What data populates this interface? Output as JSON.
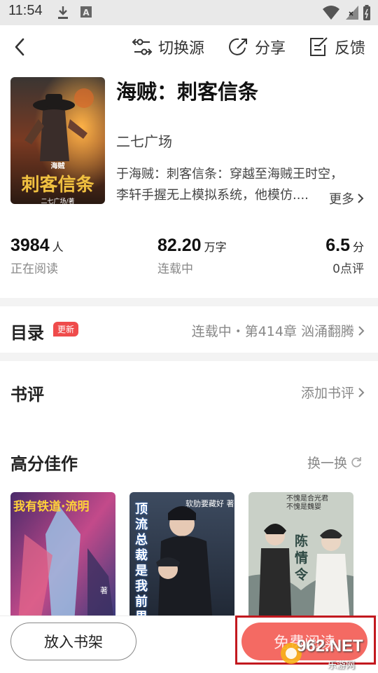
{
  "status_bar": {
    "time": "11:54"
  },
  "top_bar": {
    "switch_source": "切换源",
    "share": "分享",
    "feedback": "反馈"
  },
  "book": {
    "title": "海贼：刺客信条",
    "author": "二七广场",
    "desc_line1": "于海贼：刺客信条：穿越至海贼王时空，",
    "desc_line2": "李轩手握无上模拟系统，他模仿....",
    "more": "更多",
    "cover_title": "刺客信条",
    "cover_sub": "海贼",
    "cover_author": "二七广场/著"
  },
  "stats": [
    {
      "value": "3984",
      "unit": "人",
      "label": "正在阅读"
    },
    {
      "value": "82.20",
      "unit": "万字",
      "label": "连载中"
    },
    {
      "value": "6.5",
      "unit": "分",
      "label": "0点评"
    }
  ],
  "catalog": {
    "title": "目录",
    "badge": "更新",
    "status": "连载中・第414章 汹涌翻腾"
  },
  "review": {
    "title": "书评",
    "add": "添加书评"
  },
  "recommend": {
    "title": "高分佳作",
    "refresh": "换一换",
    "books": [
      {
        "cover_text": "我有铁道·流明",
        "author_text": "著"
      },
      {
        "cover_text": "顶流总裁是我前男友",
        "author_text": "软肋要藏好 著"
      },
      {
        "cover_text": "陈情令",
        "author_text": "不愧是合光君 不愧是魏婴"
      }
    ]
  },
  "bottom": {
    "shelf": "放入书架",
    "read": "免费阅读"
  },
  "watermark": {
    "line1": "962.NET",
    "line2": "乐游网"
  }
}
